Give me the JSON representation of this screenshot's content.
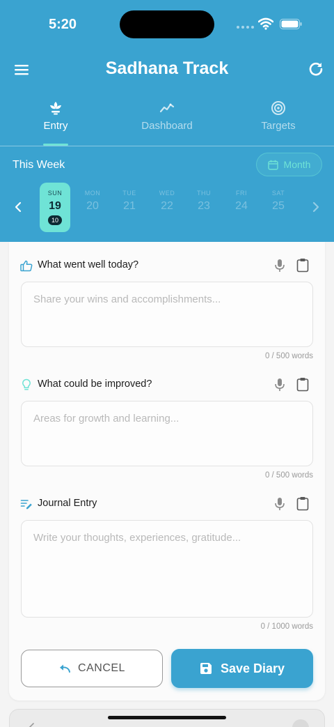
{
  "status_bar": {
    "time": "5:20"
  },
  "app": {
    "title": "Sadhana Track"
  },
  "tabs": [
    {
      "label": "Entry",
      "icon": "lotus-icon",
      "active": true
    },
    {
      "label": "Dashboard",
      "icon": "trend-icon",
      "active": false
    },
    {
      "label": "Targets",
      "icon": "target-icon",
      "active": false
    }
  ],
  "week": {
    "label": "This Week",
    "view_button": "Month",
    "days": [
      {
        "name": "SUN",
        "num": "19",
        "count": "10",
        "selected": true
      },
      {
        "name": "MON",
        "num": "20"
      },
      {
        "name": "TUE",
        "num": "21"
      },
      {
        "name": "WED",
        "num": "22"
      },
      {
        "name": "THU",
        "num": "23"
      },
      {
        "name": "FRI",
        "num": "24"
      },
      {
        "name": "SAT",
        "num": "25"
      }
    ]
  },
  "sections": [
    {
      "title": "What went well today?",
      "icon": "thumbs-up-icon",
      "placeholder": "Share your wins and accomplishments...",
      "count": "0 / 500 words"
    },
    {
      "title": "What could be improved?",
      "icon": "lightbulb-icon",
      "placeholder": "Areas for growth and learning...",
      "count": "0 / 500 words"
    },
    {
      "title": "Journal Entry",
      "icon": "notes-icon",
      "placeholder": "Write your thoughts, experiences, gratitude...",
      "count": "0 / 1000 words"
    }
  ],
  "actions": {
    "cancel": "CANCEL",
    "save": "Save Diary"
  },
  "colors": {
    "primary": "#3aa3d0",
    "accent": "#6fe3d6",
    "dark": "#0d2b33"
  }
}
